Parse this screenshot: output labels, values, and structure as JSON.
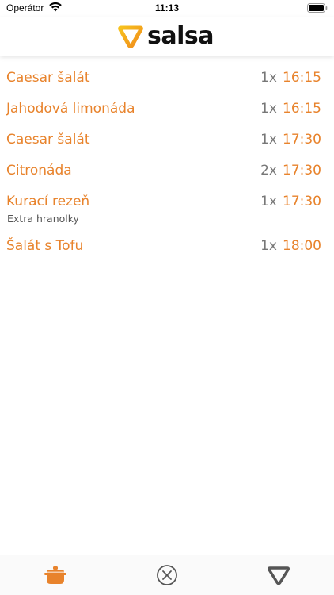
{
  "status_bar": {
    "carrier": "Operátor",
    "time": "11:13"
  },
  "header": {
    "logo_text": "salsa"
  },
  "orders": [
    {
      "name": "Caesar šalát",
      "note": "",
      "qty": "1x",
      "time": "16:15"
    },
    {
      "name": "Jahodová limonáda",
      "note": "",
      "qty": "1x",
      "time": "16:15"
    },
    {
      "name": "Caesar šalát",
      "note": "",
      "qty": "1x",
      "time": "17:30"
    },
    {
      "name": "Citronáda",
      "note": "",
      "qty": "2x",
      "time": "17:30"
    },
    {
      "name": "Kurací rezeň",
      "note": "Extra hranolky",
      "qty": "1x",
      "time": "17:30"
    },
    {
      "name": "Šalát s Tofu",
      "note": "",
      "qty": "1x",
      "time": "18:00"
    }
  ],
  "tab_bar": {
    "tabs": [
      {
        "icon": "cooking-pot-icon",
        "active": true
      },
      {
        "icon": "close-circle-icon",
        "active": false
      },
      {
        "icon": "salsa-logo-icon",
        "active": false
      }
    ]
  },
  "colors": {
    "accent": "#e8832c",
    "logo_orange": "#f39a1e",
    "logo_yellow": "#f7c21d",
    "qty_gray": "#777777",
    "inactive_icon": "#555555"
  }
}
